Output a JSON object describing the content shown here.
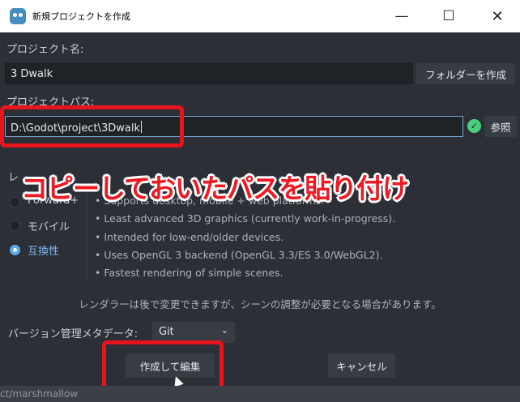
{
  "window": {
    "title": "新規プロジェクトを作成",
    "minimize": "—",
    "maximize": "☐",
    "close": "✕"
  },
  "project_name": {
    "label": "プロジェクト名:",
    "value": "3 Dwalk",
    "create_folder_button": "フォルダーを作成"
  },
  "project_path": {
    "label": "プロジェクトパス:",
    "value": "D:\\Godot\\project\\3Dwalk",
    "browse_button": "参照",
    "valid_icon": "check-icon"
  },
  "renderer": {
    "label_fragment": "レ",
    "options": [
      {
        "label": "Forward+",
        "selected": false
      },
      {
        "label": "モバイル",
        "selected": false
      },
      {
        "label": "互換性",
        "selected": true
      }
    ],
    "description": [
      "• Supports desktop, mobile + web platforms.",
      "• Least advanced 3D graphics (currently work-in-progress).",
      "• Intended for low-end/older devices.",
      "• Uses OpenGL 3 backend (OpenGL 3.3/ES 3.0/WebGL2).",
      "• Fastest rendering of simple scenes."
    ],
    "note": "レンダラーは後で変更できますが、シーンの調整が必要となる場合があります。"
  },
  "annotation": "コピーしておいたパスを貼り付け",
  "vcs": {
    "label": "バージョン管理メタデータ:",
    "value": "Git"
  },
  "buttons": {
    "create_edit": "作成して編集",
    "cancel": "キャンセル"
  },
  "background_path": "ct/marshmallow",
  "colors": {
    "accent": "#5aa9f0",
    "highlight": "#e8141c",
    "valid": "#48d17b"
  }
}
